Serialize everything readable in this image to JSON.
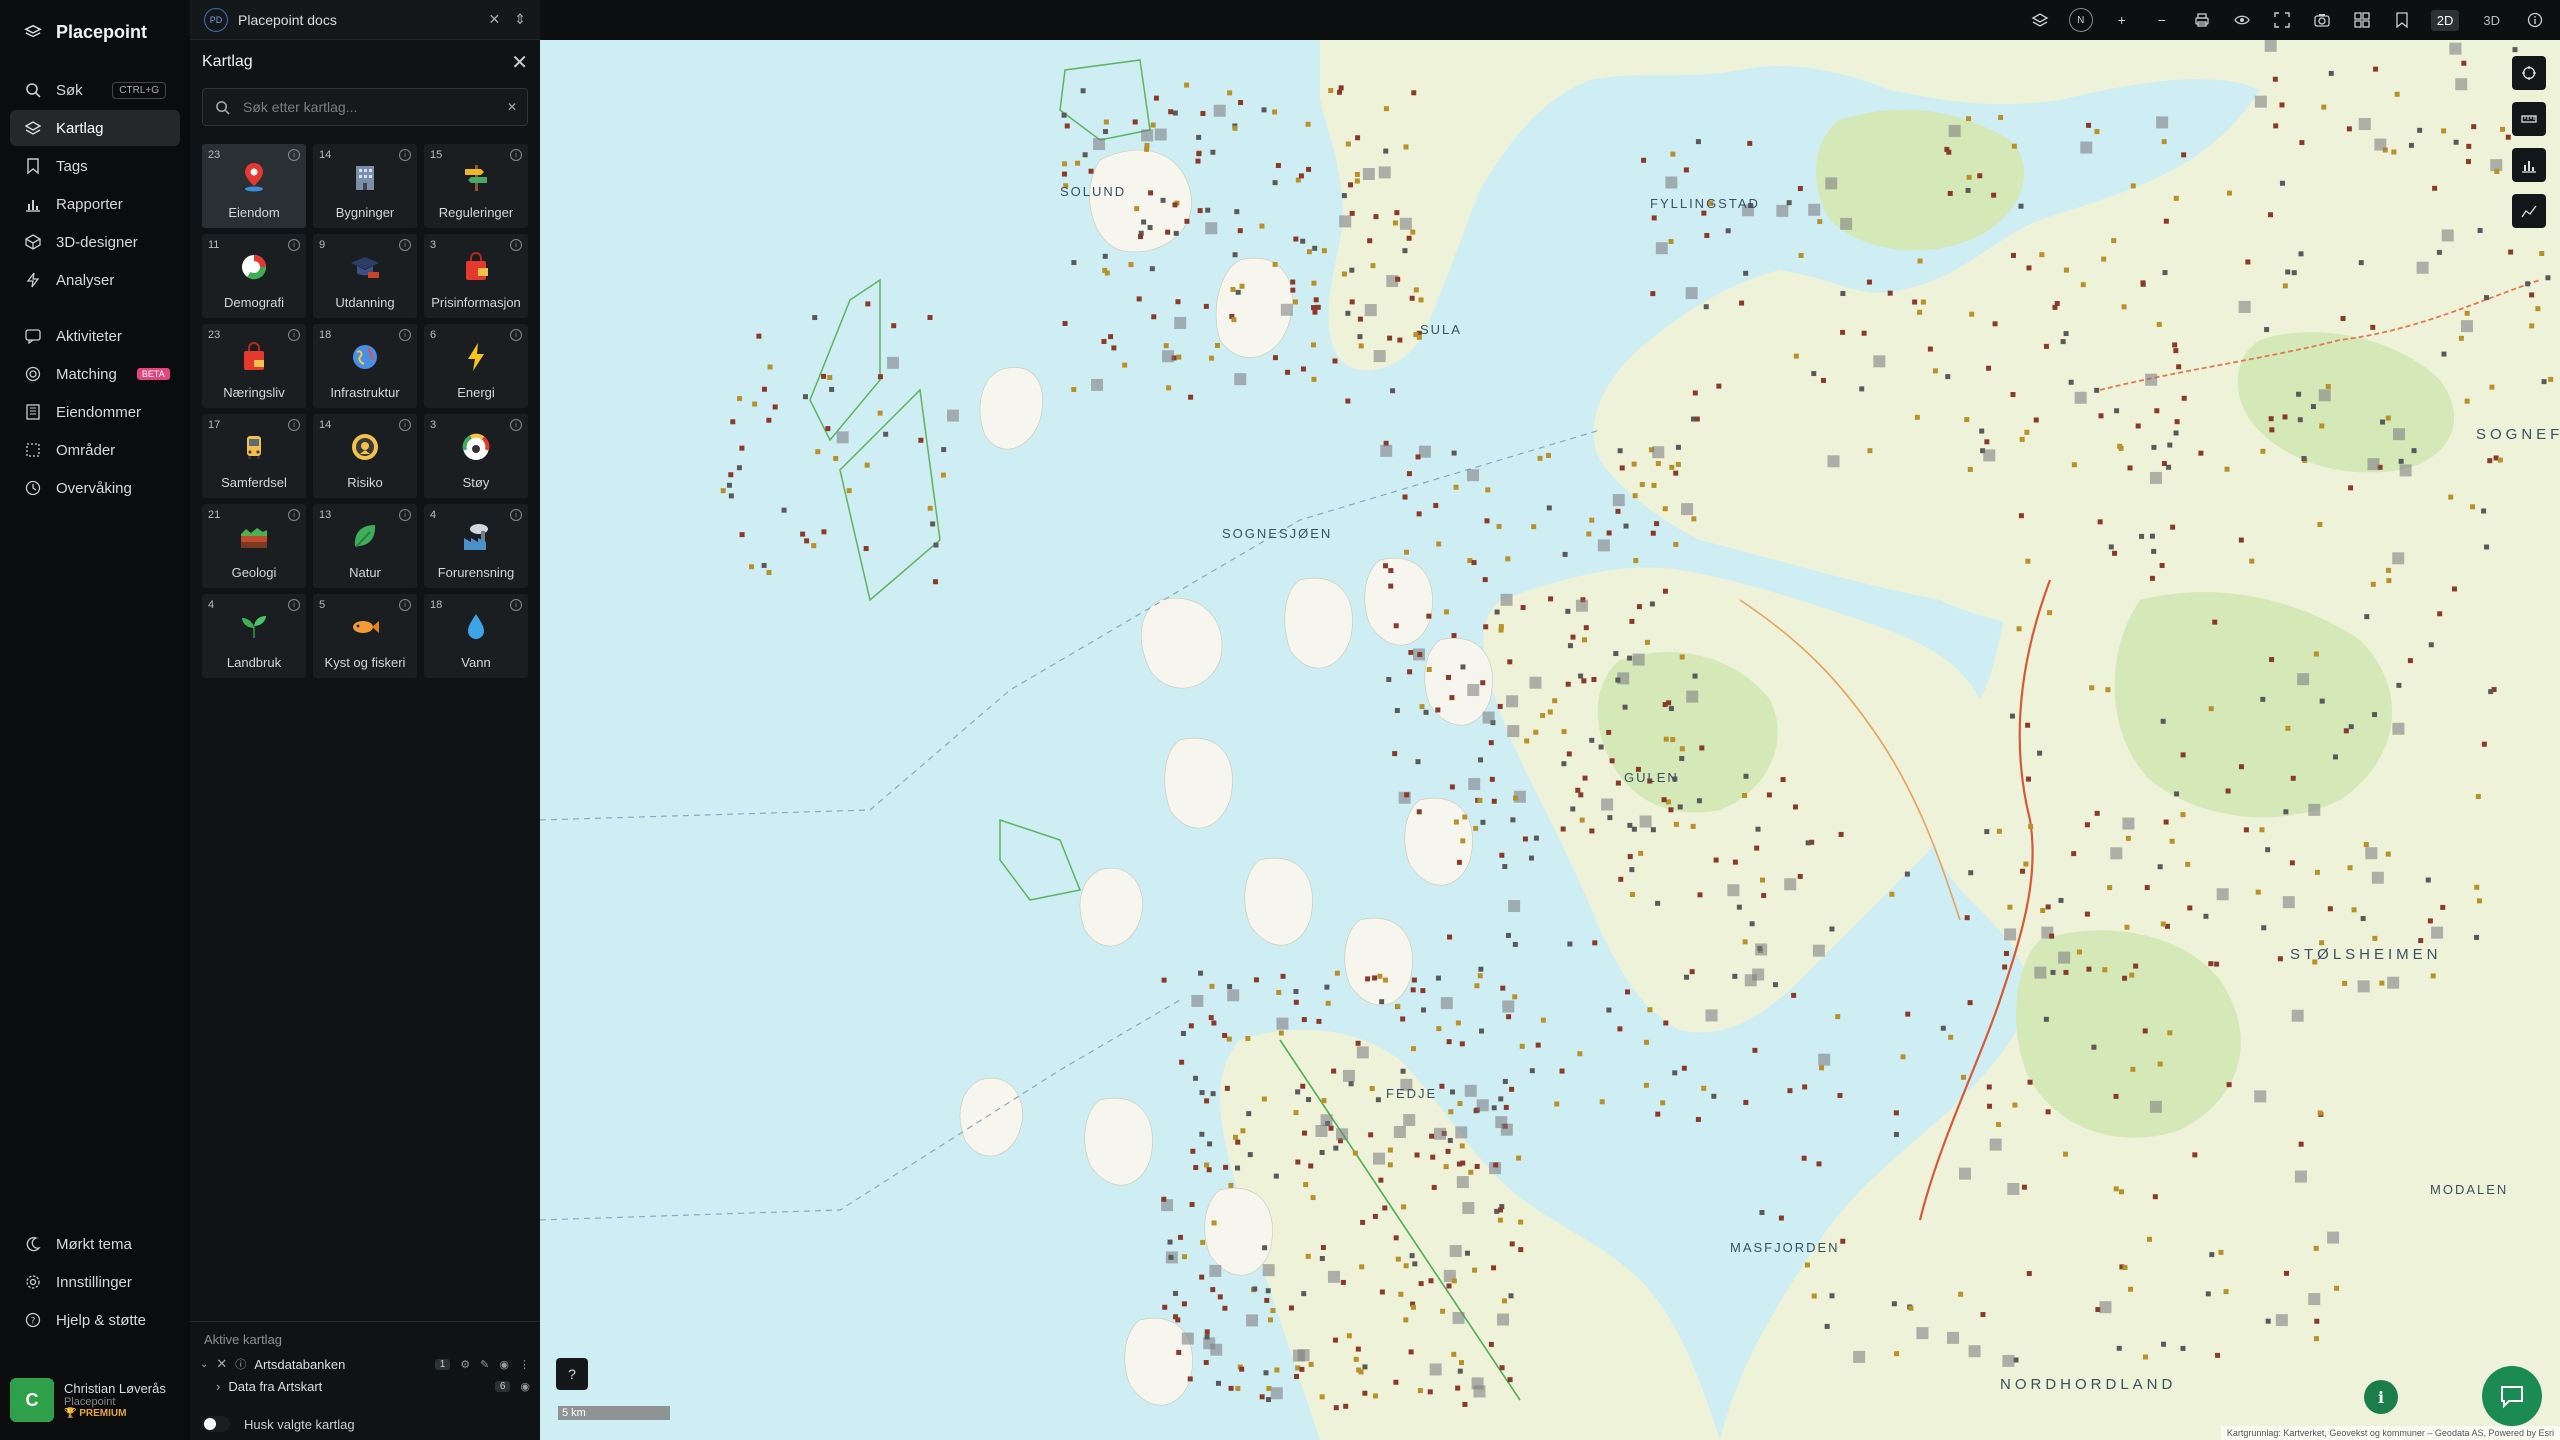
{
  "app": {
    "name": "Placepoint"
  },
  "nav": {
    "items": [
      {
        "label": "Søk",
        "shortcut": "CTRL+G"
      },
      {
        "label": "Kartlag"
      },
      {
        "label": "Tags"
      },
      {
        "label": "Rapporter"
      },
      {
        "label": "3D-designer"
      },
      {
        "label": "Analyser"
      },
      {
        "label": "Aktiviteter"
      },
      {
        "label": "Matching",
        "badge": "BETA"
      },
      {
        "label": "Eiendommer"
      },
      {
        "label": "Områder"
      },
      {
        "label": "Overvåking"
      }
    ],
    "bottom": [
      {
        "label": "Mørkt tema"
      },
      {
        "label": "Innstillinger"
      },
      {
        "label": "Hjelp & støtte"
      }
    ],
    "user": {
      "initial": "C",
      "name": "Christian Løverås",
      "org": "Placepoint",
      "plan": "PREMIUM"
    }
  },
  "doc": {
    "badge": "PD",
    "title": "Placepoint docs"
  },
  "panel": {
    "title": "Kartlag",
    "search_placeholder": "Søk etter kartlag...",
    "categories": [
      {
        "count": "23",
        "label": "Eiendom"
      },
      {
        "count": "14",
        "label": "Bygninger"
      },
      {
        "count": "15",
        "label": "Reguleringer"
      },
      {
        "count": "11",
        "label": "Demografi"
      },
      {
        "count": "9",
        "label": "Utdanning"
      },
      {
        "count": "3",
        "label": "Prisinformasjon"
      },
      {
        "count": "23",
        "label": "Næringsliv"
      },
      {
        "count": "18",
        "label": "Infrastruktur"
      },
      {
        "count": "6",
        "label": "Energi"
      },
      {
        "count": "17",
        "label": "Samferdsel"
      },
      {
        "count": "14",
        "label": "Risiko"
      },
      {
        "count": "3",
        "label": "Støy"
      },
      {
        "count": "21",
        "label": "Geologi"
      },
      {
        "count": "13",
        "label": "Natur"
      },
      {
        "count": "4",
        "label": "Forurensning"
      },
      {
        "count": "4",
        "label": "Landbruk"
      },
      {
        "count": "5",
        "label": "Kyst og fiskeri"
      },
      {
        "count": "18",
        "label": "Vann"
      }
    ],
    "active": {
      "title": "Aktive kartlag",
      "layer": {
        "name": "Artsdatabanken",
        "count": "1"
      },
      "sublayer": {
        "name": "Data fra Artskart",
        "count": "6"
      },
      "remember": "Husk valgte kartlag"
    }
  },
  "toolbar": {
    "compass": "N",
    "mode2d": "2D",
    "mode3d": "3D"
  },
  "map": {
    "scale": "5 km",
    "attribution": "Kartgrunnlag: Kartverket, Geovekst og kommuner – Geodata AS, Powered by Esri",
    "labels": [
      {
        "t": "SOLUND"
      },
      {
        "t": "SULA"
      },
      {
        "t": "SOGNESJØEN"
      },
      {
        "t": "GULEN"
      },
      {
        "t": "FEDJE"
      },
      {
        "t": "SOGNEF"
      },
      {
        "t": "STØLSHEIMEN"
      },
      {
        "t": "MASFJORDEN"
      },
      {
        "t": "NORDHORDLAND"
      },
      {
        "t": "FYLLINGSTAD"
      },
      {
        "t": "MODALEN"
      }
    ]
  }
}
